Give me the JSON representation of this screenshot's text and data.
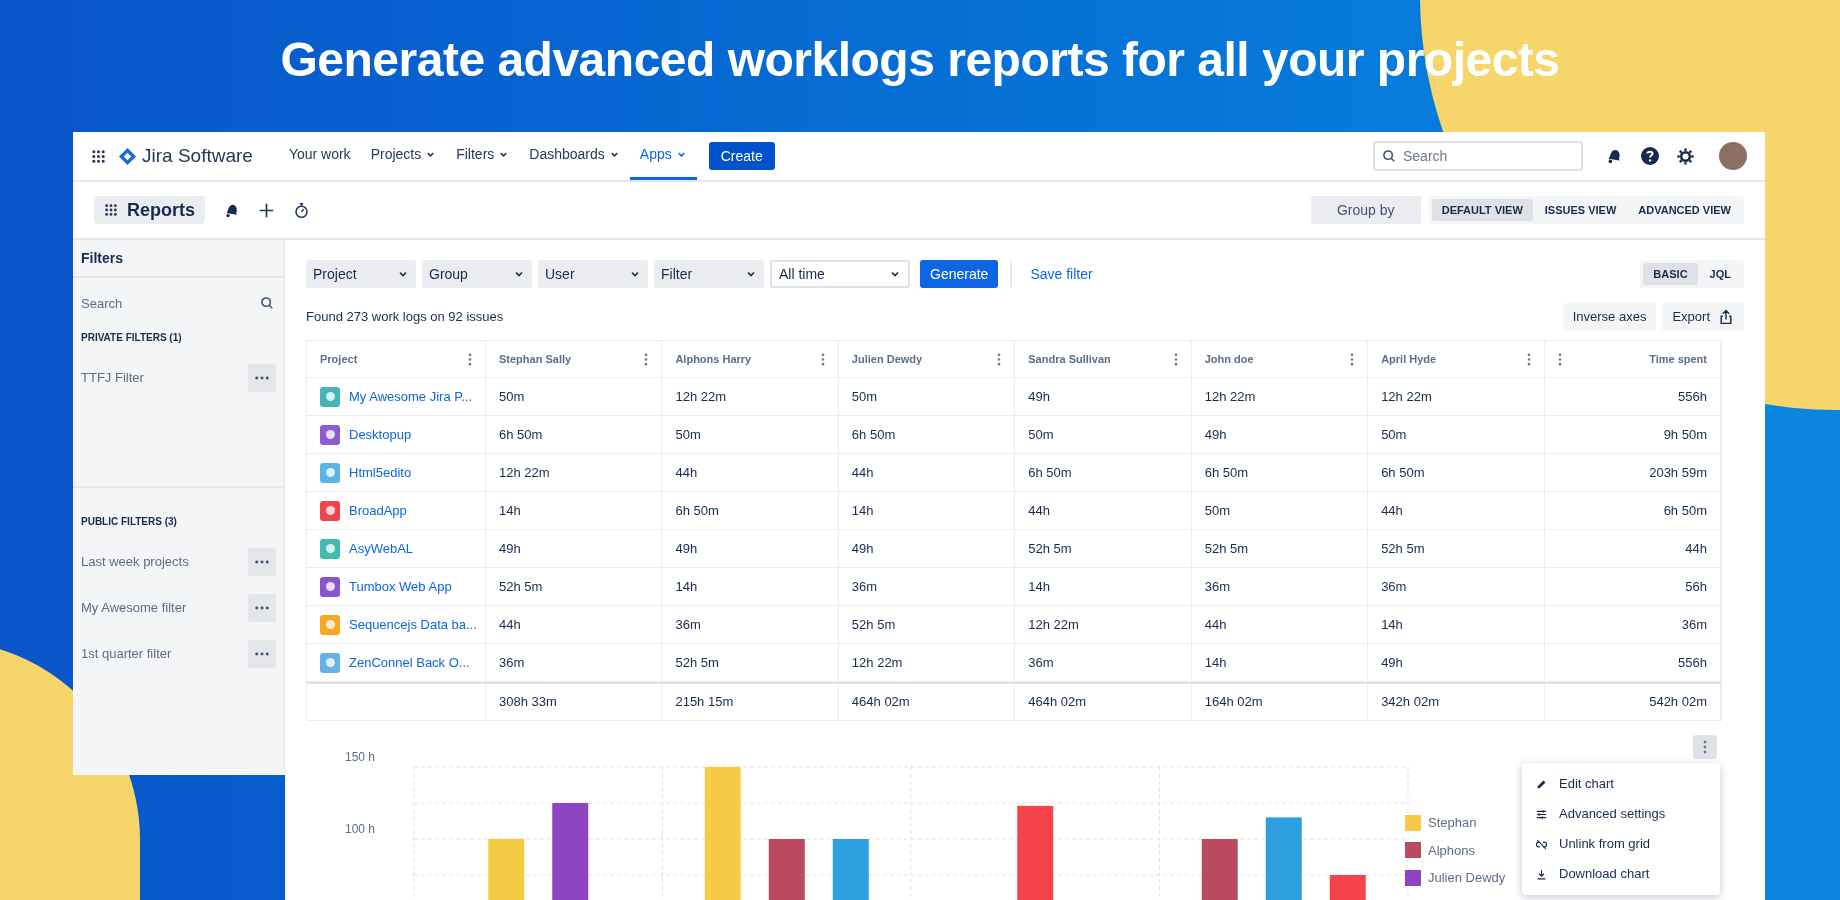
{
  "headline": "Generate advanced worklogs reports for all your projects",
  "nav": {
    "product": "Jira Software",
    "items": [
      {
        "label": "Your work",
        "dropdown": false,
        "selected": false
      },
      {
        "label": "Projects",
        "dropdown": true,
        "selected": false
      },
      {
        "label": "Filters",
        "dropdown": true,
        "selected": false
      },
      {
        "label": "Dashboards",
        "dropdown": true,
        "selected": false
      },
      {
        "label": "Apps",
        "dropdown": true,
        "selected": true
      }
    ],
    "create": "Create",
    "search": {
      "placeholder": "Search"
    }
  },
  "subbar": {
    "title": "Reports",
    "group_by": "Group by",
    "views": [
      {
        "label": "DEFAULT VIEW",
        "selected": true
      },
      {
        "label": "ISSUES VIEW",
        "selected": false
      },
      {
        "label": "ADVANCED VIEW",
        "selected": false
      }
    ]
  },
  "sidebar": {
    "title": "Filters",
    "search": {
      "placeholder": "Search"
    },
    "sections": [
      {
        "title": "PRIVATE FILTERS (1)",
        "items": [
          "TTFJ Filter"
        ]
      },
      {
        "title": "PUBLIC FILTERS (3)",
        "items": [
          "Last week projects",
          "My Awesome filter",
          "1st quarter filter"
        ]
      }
    ]
  },
  "filters": [
    {
      "label": "Project",
      "kind": "empty"
    },
    {
      "label": "Group",
      "kind": "empty"
    },
    {
      "label": "User",
      "kind": "empty"
    },
    {
      "label": "Filter",
      "kind": "empty"
    },
    {
      "label": "All time",
      "kind": "chosen"
    }
  ],
  "generate": "Generate",
  "save_filter": "Save filter",
  "modes": [
    {
      "label": "BASIC",
      "selected": true
    },
    {
      "label": "JQL",
      "selected": false
    }
  ],
  "summary": "Found 273 work logs on 92 issues",
  "inverse_axes": "Inverse axes",
  "export": "Export",
  "table": {
    "columns": [
      "Project",
      "Stephan Sally",
      "Alphons Harry",
      "Julien Dewdy",
      "Sandra Sullivan",
      "John doe",
      "April Hyde",
      "Time spent"
    ],
    "rows": [
      {
        "color": "#45b5b8",
        "cells": [
          "My Awesome Jira P...",
          "50m",
          "12h 22m",
          "50m",
          "49h",
          "12h 22m",
          "12h 22m",
          "556h"
        ]
      },
      {
        "color": "#8e5bd0",
        "cells": [
          "Desktopup",
          "6h 50m",
          "50m",
          "6h 50m",
          "50m",
          "49h",
          "50m",
          "9h 50m"
        ]
      },
      {
        "color": "#5ab4e6",
        "cells": [
          "Html5edito",
          "12h 22m",
          "44h",
          "44h",
          "6h 50m",
          "6h 50m",
          "6h 50m",
          "203h 59m"
        ]
      },
      {
        "color": "#f0434a",
        "cells": [
          "BroadApp",
          "14h",
          "6h 50m",
          "14h",
          "44h",
          "50m",
          "44h",
          "6h 50m"
        ]
      },
      {
        "color": "#3fbcb0",
        "cells": [
          "AsyWebAL",
          "49h",
          "49h",
          "49h",
          "52h 5m",
          "52h 5m",
          "52h 5m",
          "44h"
        ]
      },
      {
        "color": "#8a55cc",
        "cells": [
          "Tumbox Web App",
          "52h 5m",
          "14h",
          "36m",
          "14h",
          "36m",
          "36m",
          "56h"
        ]
      },
      {
        "color": "#f6a823",
        "cells": [
          "Sequencejs Data ba...",
          "44h",
          "36m",
          "52h 5m",
          "12h 22m",
          "44h",
          "14h",
          "36m"
        ]
      },
      {
        "color": "#62b3e4",
        "cells": [
          "ZenConnel Back O...",
          "36m",
          "52h 5m",
          "12h 22m",
          "36m",
          "14h",
          "49h",
          "556h"
        ]
      }
    ],
    "totals": [
      "308h 33m",
      "215h 15m",
      "464h 02m",
      "464h 02m",
      "164h 02m",
      "342h 02m",
      "542h 02m"
    ]
  },
  "chart": {
    "chart_data": {
      "type": "bar",
      "ylim": [
        0,
        150
      ],
      "yticks": [
        {
          "value": 100,
          "label": "100 h"
        },
        {
          "value": 150,
          "label": "150 h"
        }
      ],
      "series": [
        {
          "name": "Stephan",
          "color": "#f5cb45",
          "values": [
            100,
            150,
            null,
            null
          ]
        },
        {
          "name": "Alphons",
          "color": "#b94a5f",
          "values": [
            null,
            100,
            null,
            100
          ]
        },
        {
          "name": "Julien Dewdy",
          "color": "#8e44c0",
          "values": [
            125,
            null,
            null,
            null
          ]
        },
        {
          "color": "#2e9fde",
          "values": [
            null,
            100,
            null,
            115
          ]
        },
        {
          "color": "#f5434a",
          "values": [
            null,
            null,
            123,
            75
          ]
        }
      ]
    },
    "menu": [
      "Edit chart",
      "Advanced settings",
      "Unlink from grid",
      "Download chart"
    ]
  }
}
